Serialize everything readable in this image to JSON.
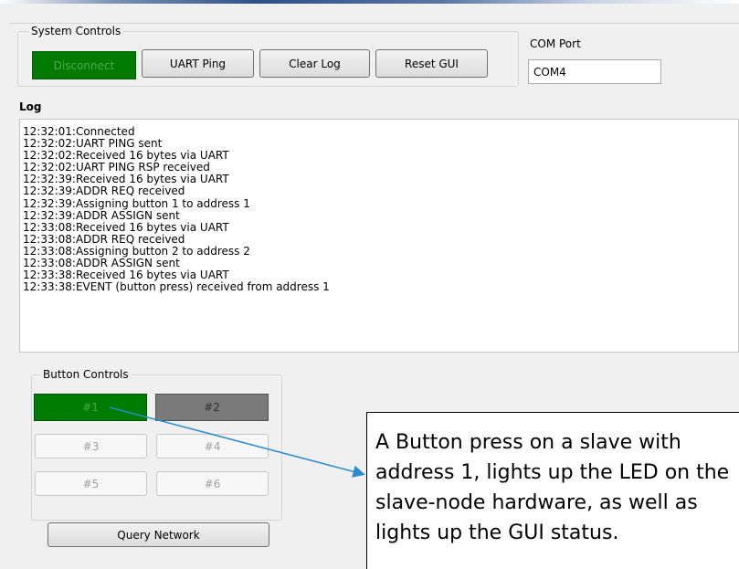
{
  "system_controls": {
    "legend": "System Controls",
    "disconnect_label": "Disconnect",
    "uart_ping_label": "UART Ping",
    "clear_log_label": "Clear Log",
    "reset_gui_label": "Reset GUI"
  },
  "com_port": {
    "label": "COM Port",
    "value": "COM4"
  },
  "log": {
    "title": "Log",
    "lines": [
      "12:32:01:Connected",
      "12:32:02:UART PING sent",
      "12:32:02:Received 16 bytes via UART",
      "12:32:02:UART PING RSP received",
      "12:32:39:Received 16 bytes via UART",
      "12:32:39:ADDR REQ received",
      "12:32:39:Assigning button 1 to address 1",
      "12:32:39:ADDR ASSIGN sent",
      "12:33:08:Received 16 bytes via UART",
      "12:33:08:ADDR REQ received",
      "12:33:08:Assigning button 2 to address 2",
      "12:33:08:ADDR ASSIGN sent",
      "12:33:38:Received 16 bytes via UART",
      "12:33:38:EVENT (button press) received from address 1"
    ]
  },
  "button_controls": {
    "legend": "Button Controls",
    "buttons": [
      "#1",
      "#2",
      "#3",
      "#4",
      "#5",
      "#6"
    ],
    "query_network_label": "Query Network"
  },
  "callout": {
    "text": "A Button press on a slave with address 1, lights up the LED on the slave-node hardware, as well as lights up the GUI status."
  },
  "colors": {
    "led_on": "#007d00",
    "led_gray": "#7a7a7a",
    "arrow": "#2a8ccf"
  }
}
